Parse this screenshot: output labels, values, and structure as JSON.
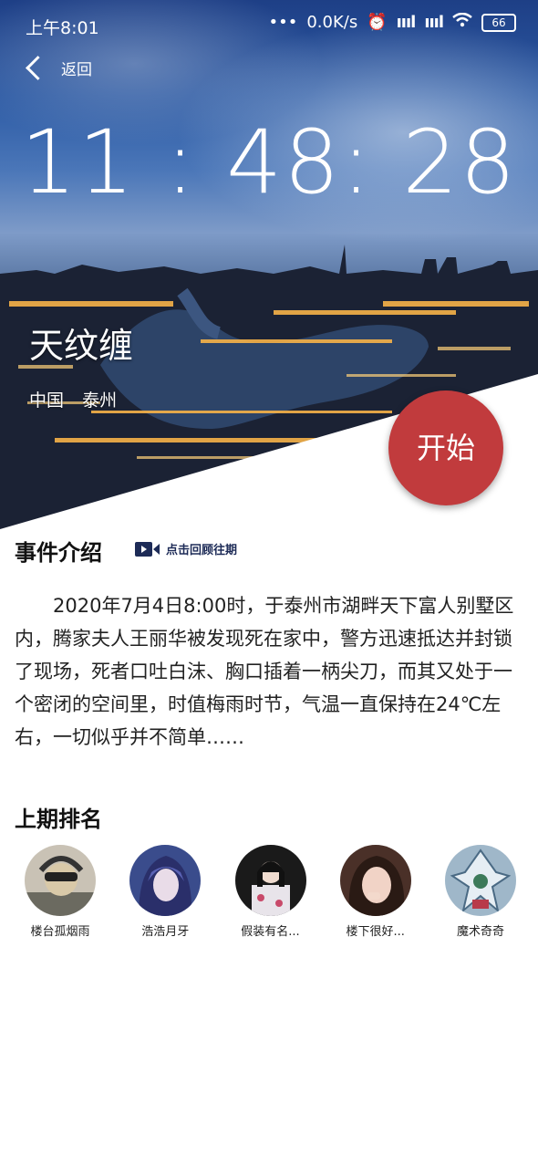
{
  "status_bar": {
    "time": "上午8:01",
    "speed": "0.0K/s",
    "battery": "66"
  },
  "nav": {
    "back_label": "返回"
  },
  "countdown": "11 : 48: 28",
  "event": {
    "title": "天纹缠",
    "country": "中国",
    "city": "泰州",
    "start_label": "开始"
  },
  "intro": {
    "heading": "事件介绍",
    "replay_label": "点击回顾往期",
    "description": "2020年7月4日8:00时，于泰州市湖畔天下富人别墅区内，腾家夫人王丽华被发现死在家中，警方迅速抵达并封锁了现场，死者口吐白沫、胸口插着一柄尖刀，而其又处于一个密闭的空间里，时值梅雨时节，气温一直保持在24℃左右，一切似乎并不简单……"
  },
  "ranking": {
    "heading": "上期排名",
    "users": [
      {
        "name": "楼台孤烟雨"
      },
      {
        "name": "浩浩月牙"
      },
      {
        "name": "假装有名..."
      },
      {
        "name": "楼下很好..."
      },
      {
        "name": "魔术奇奇"
      }
    ]
  },
  "colors": {
    "accent": "#c13b3d",
    "replay_icon": "#1d2b57"
  }
}
